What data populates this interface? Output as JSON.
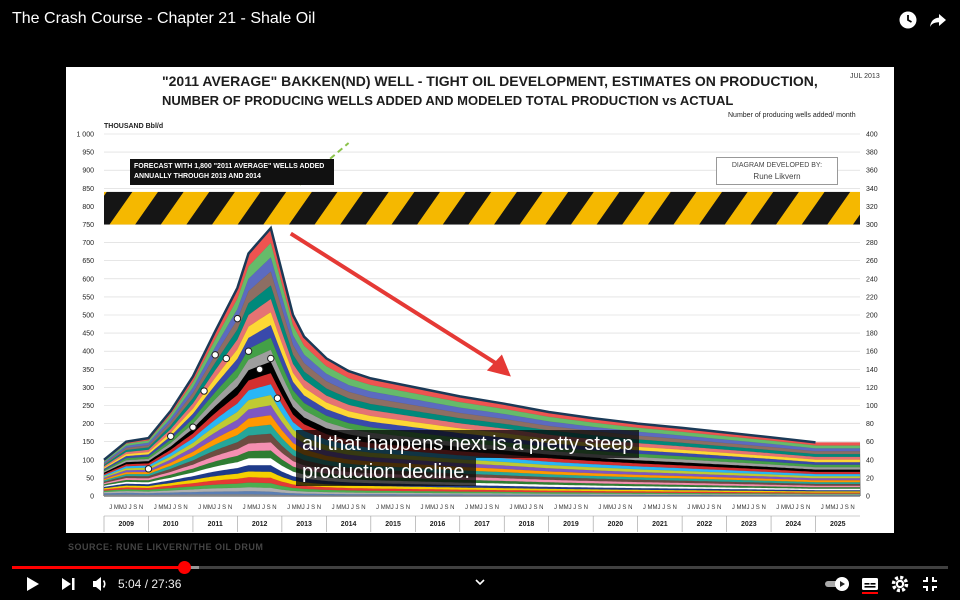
{
  "window": {
    "title": "The Crash Course - Chapter 21 - Shale Oil",
    "icons": [
      "clock-icon",
      "share-icon"
    ]
  },
  "slide": {
    "title_line1": "\"2011 AVERAGE\" BAKKEN(ND) WELL - TIGHT OIL DEVELOPMENT, ESTIMATES ON PRODUCTION,",
    "title_line2": "NUMBER OF PRODUCING WELLS ADDED AND MODELED TOTAL PRODUCTION vs ACTUAL",
    "date": "JUL 2013",
    "forecast_box": "FORECAST WITH 1,800 \"2011 AVERAGE\" WELLS ADDED ANNUALLY THROUGH 2013 AND 2014",
    "credit_box_line1": "DIAGRAM DEVELOPED BY:",
    "credit_box_line2": "Rune Likvern",
    "source": "SOURCE: RUNE LIKVERN/THE OIL DRUM"
  },
  "chart_data": {
    "type": "area",
    "title": "\"2011 AVERAGE\" BAKKEN(ND) WELL - TIGHT OIL DEVELOPMENT, ESTIMATES ON PRODUCTION, NUMBER OF PRODUCING WELLS ADDED AND MODELED TOTAL PRODUCTION vs ACTUAL",
    "ylabel": "THOUSAND Bbl/d",
    "y2label": "Number of producing wells added/ month",
    "ylim": [
      0,
      1000
    ],
    "y2lim": [
      0,
      400
    ],
    "yticks": [
      "0",
      "50",
      "100",
      "150",
      "200",
      "250",
      "300",
      "350",
      "400",
      "450",
      "500",
      "550",
      "600",
      "650",
      "700",
      "750",
      "800",
      "850",
      "900",
      "950",
      "1 000"
    ],
    "y2ticks": [
      "0",
      "20",
      "40",
      "60",
      "80",
      "100",
      "120",
      "140",
      "160",
      "180",
      "200",
      "220",
      "240",
      "260",
      "280",
      "300",
      "320",
      "340",
      "360",
      "380",
      "400"
    ],
    "years": [
      "2009",
      "2010",
      "2011",
      "2012",
      "2013",
      "2014",
      "2015",
      "2016",
      "2017",
      "2018",
      "2019",
      "2020",
      "2021",
      "2022",
      "2023",
      "2024",
      "2025"
    ],
    "month_labels": "J MMJ J S N",
    "total_production": {
      "x": [
        2009.0,
        2009.5,
        2010.0,
        2010.5,
        2011.0,
        2011.5,
        2012.0,
        2012.25,
        2012.5,
        2012.75,
        2013.0,
        2013.25,
        2013.5,
        2014.0,
        2014.5,
        2015.0,
        2016.0,
        2017.0,
        2018.0,
        2019.0,
        2020.0,
        2021.0,
        2022.0,
        2023.0,
        2024.0,
        2025.0
      ],
      "y": [
        100,
        150,
        160,
        235,
        330,
        455,
        575,
        670,
        705,
        740,
        620,
        500,
        440,
        380,
        345,
        325,
        300,
        275,
        255,
        232,
        215,
        200,
        188,
        175,
        162,
        148
      ]
    },
    "actual_points": {
      "x": [
        2010.0,
        2010.5,
        2011.0,
        2011.25,
        2011.5,
        2011.75,
        2012.0,
        2012.25,
        2012.5,
        2012.75,
        2012.9
      ],
      "y": [
        75,
        165,
        190,
        290,
        390,
        380,
        490,
        400,
        350,
        380,
        270
      ]
    },
    "annotations": [
      "FORECAST WITH 1,800 \"2011 AVERAGE\" WELLS ADDED ANNUALLY THROUGH 2013 AND 2014",
      "DIAGRAM DEVELOPED BY: Rune Likvern"
    ],
    "legend": "none",
    "grid": true
  },
  "caption": {
    "line1": "all that happens next is a pretty steep",
    "line2": "production decline."
  },
  "player": {
    "time": "5:04 / 27:36",
    "played_fraction": 0.184,
    "buffered_fraction": 0.2
  },
  "colors": {
    "progress": "#ff0000",
    "area_base": "#8c8c8c",
    "stripe_yellow": "#f5b800",
    "arrow": "#e53935",
    "outline": "#1b3a57"
  }
}
